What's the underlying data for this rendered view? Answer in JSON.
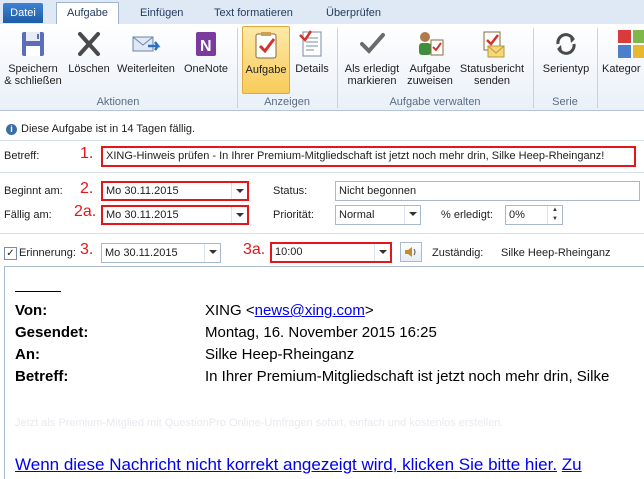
{
  "tabs": [
    "Datei",
    "Aufgabe",
    "Einfügen",
    "Text formatieren",
    "Überprüfen"
  ],
  "ribbon": {
    "actions": {
      "save_close": "Speichern\n& schließen",
      "delete": "Löschen",
      "forward": "Weiterleiten",
      "onenote": "OneNote",
      "group_label": "Aktionen"
    },
    "show": {
      "task": "Aufgabe",
      "details": "Details",
      "group_label": "Anzeigen"
    },
    "manage": {
      "mark_complete": "Als erledigt\nmarkieren",
      "assign": "Aufgabe\nzuweisen",
      "status_report": "Statusbericht\nsenden",
      "group_label": "Aufgabe verwalten"
    },
    "series": {
      "type": "Serientyp",
      "group_label": "Serie"
    },
    "categorize": "Kategor"
  },
  "info_text": "Diese Aufgabe ist in 14 Tagen fällig.",
  "form": {
    "subject_label": "Betreff:",
    "subject_value": "XING-Hinweis prüfen - In Ihrer Premium-Mitgliedschaft ist jetzt noch mehr drin, Silke Heep-Rheinganz!",
    "start_label": "Beginnt am:",
    "start_value": "Mo 30.11.2015",
    "due_label": "Fällig am:",
    "due_value": "Mo 30.11.2015",
    "status_label": "Status:",
    "status_value": "Nicht begonnen",
    "priority_label": "Priorität:",
    "priority_value": "Normal",
    "percent_label": "% erledigt:",
    "percent_value": "0%",
    "reminder_label": "Erinnerung:",
    "reminder_date": "Mo 30.11.2015",
    "reminder_time": "10:00",
    "owner_label": "Zuständig:",
    "owner_value": "Silke Heep-Rheinganz"
  },
  "annotations": [
    "1.",
    "2.",
    "2a.",
    "3.",
    "3a."
  ],
  "mail": {
    "from_label": "Von:",
    "from_name": "XING <",
    "from_email": "news@xing.com",
    "from_close": ">",
    "sent_label": "Gesendet:",
    "sent_value": "Montag, 16. November 2015 16:25",
    "to_label": "An:",
    "to_value": "Silke Heep-Rheinganz",
    "subject_label": "Betreff:",
    "subject_value": "In Ihrer Premium-Mitgliedschaft ist jetzt noch mehr drin, Silke",
    "faint_text": "Jetzt als Premium-Mitglied mit QuestionPro Online-Umfragen sofort, einfach und kostenlos erstellen.",
    "link_text": "Wenn diese Nachricht nicht korrekt angezeigt wird, klicken Sie bitte hier.",
    "link_tail": "Zu"
  }
}
